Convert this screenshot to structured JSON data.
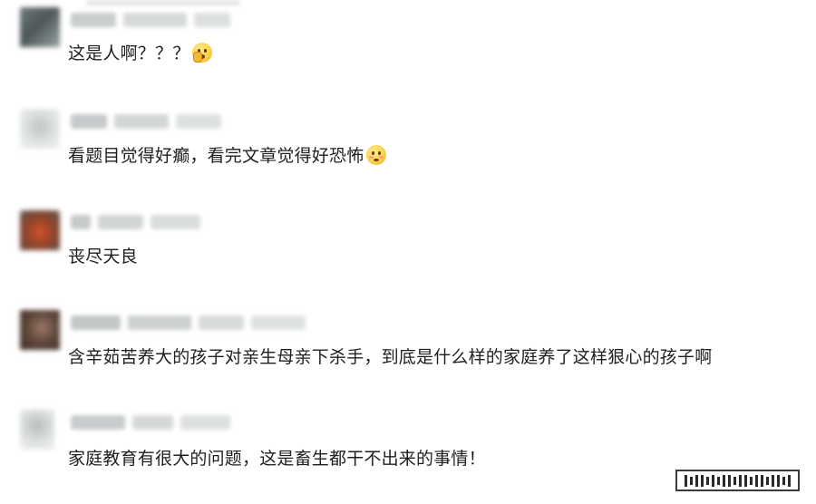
{
  "comments": [
    {
      "text": "这是人啊？？？",
      "emoji": "tear-smile-emoji",
      "avatar_colors": [
        "#5b6668",
        "#8d9998"
      ]
    },
    {
      "text": "看题目觉得好癫，看完文章觉得好恐怖",
      "emoji": "flushed-emoji",
      "avatar_colors": [
        "#c9cfcf",
        "#e6eaea"
      ]
    },
    {
      "text": "丧尽天良",
      "emoji": "",
      "avatar_colors": [
        "#7a3a24",
        "#cf5030"
      ]
    },
    {
      "text": "含辛茹苦养大的孩子对亲生母亲下杀手，到底是什么样的家庭养了这样狠心的孩子啊",
      "emoji": "",
      "avatar_colors": [
        "#4c3a2f",
        "#8a6a5a"
      ]
    },
    {
      "text": "家庭教育有很大的问题，这是畜生都干不出来的事情！",
      "emoji": "",
      "avatar_colors": [
        "#c4c8c8",
        "#e8eaea"
      ]
    }
  ],
  "colors": {
    "text": "#1f1f1f",
    "meta_blur": "#c7cbcc",
    "background": "#ffffff"
  }
}
